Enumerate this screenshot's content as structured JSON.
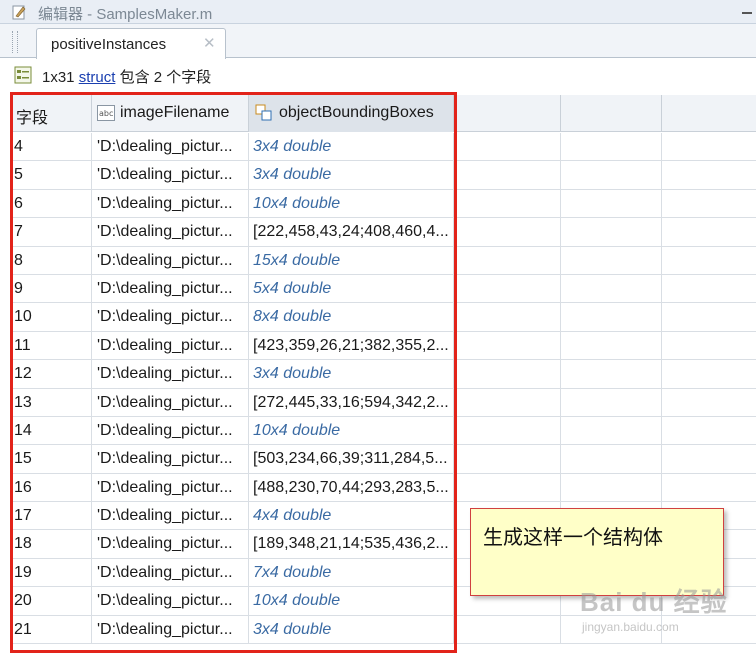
{
  "window": {
    "title": "编辑器 - SamplesMaker.m"
  },
  "tabs": [
    {
      "label": "positiveInstances",
      "close": "✕"
    }
  ],
  "info": {
    "size": "1x31",
    "type_link": "struct",
    "text_mid": "包含",
    "count": "2",
    "text_end": "个字段"
  },
  "table": {
    "columns": [
      "字段",
      "imageFilename",
      "objectBoundingBoxes"
    ],
    "column_icons": [
      "abc-icon",
      "cell-array-icon"
    ],
    "rows": [
      {
        "id": "4",
        "file": "'D:\\dealing_pictur...",
        "boxes": "3x4 double",
        "summary": true
      },
      {
        "id": "5",
        "file": "'D:\\dealing_pictur...",
        "boxes": "3x4 double",
        "summary": true
      },
      {
        "id": "6",
        "file": "'D:\\dealing_pictur...",
        "boxes": "10x4 double",
        "summary": true
      },
      {
        "id": "7",
        "file": "'D:\\dealing_pictur...",
        "boxes": "[222,458,43,24;408,460,4...",
        "summary": false
      },
      {
        "id": "8",
        "file": "'D:\\dealing_pictur...",
        "boxes": "15x4 double",
        "summary": true
      },
      {
        "id": "9",
        "file": "'D:\\dealing_pictur...",
        "boxes": "5x4 double",
        "summary": true
      },
      {
        "id": "10",
        "file": "'D:\\dealing_pictur...",
        "boxes": "8x4 double",
        "summary": true
      },
      {
        "id": "11",
        "file": "'D:\\dealing_pictur...",
        "boxes": "[423,359,26,21;382,355,2...",
        "summary": false
      },
      {
        "id": "12",
        "file": "'D:\\dealing_pictur...",
        "boxes": "3x4 double",
        "summary": true
      },
      {
        "id": "13",
        "file": "'D:\\dealing_pictur...",
        "boxes": "[272,445,33,16;594,342,2...",
        "summary": false
      },
      {
        "id": "14",
        "file": "'D:\\dealing_pictur...",
        "boxes": "10x4 double",
        "summary": true
      },
      {
        "id": "15",
        "file": "'D:\\dealing_pictur...",
        "boxes": "[503,234,66,39;311,284,5...",
        "summary": false
      },
      {
        "id": "16",
        "file": "'D:\\dealing_pictur...",
        "boxes": "[488,230,70,44;293,283,5...",
        "summary": false
      },
      {
        "id": "17",
        "file": "'D:\\dealing_pictur...",
        "boxes": "4x4 double",
        "summary": true
      },
      {
        "id": "18",
        "file": "'D:\\dealing_pictur...",
        "boxes": "[189,348,21,14;535,436,2...",
        "summary": false
      },
      {
        "id": "19",
        "file": "'D:\\dealing_pictur...",
        "boxes": "7x4 double",
        "summary": true
      },
      {
        "id": "20",
        "file": "'D:\\dealing_pictur...",
        "boxes": "10x4 double",
        "summary": true
      },
      {
        "id": "21",
        "file": "'D:\\dealing_pictur...",
        "boxes": "3x4 double",
        "summary": true
      }
    ]
  },
  "annotation": {
    "text": "生成这样一个结构体",
    "highlight_color": "#e2231a",
    "note_bg": "#ffffc8"
  },
  "watermark": {
    "main": "Bai du 经验",
    "sub": "jingyan.baidu.com"
  },
  "colors": {
    "link": "#1a3fb0",
    "summary_text": "#3a6aa3",
    "header_bg": "#f0f3f7"
  }
}
